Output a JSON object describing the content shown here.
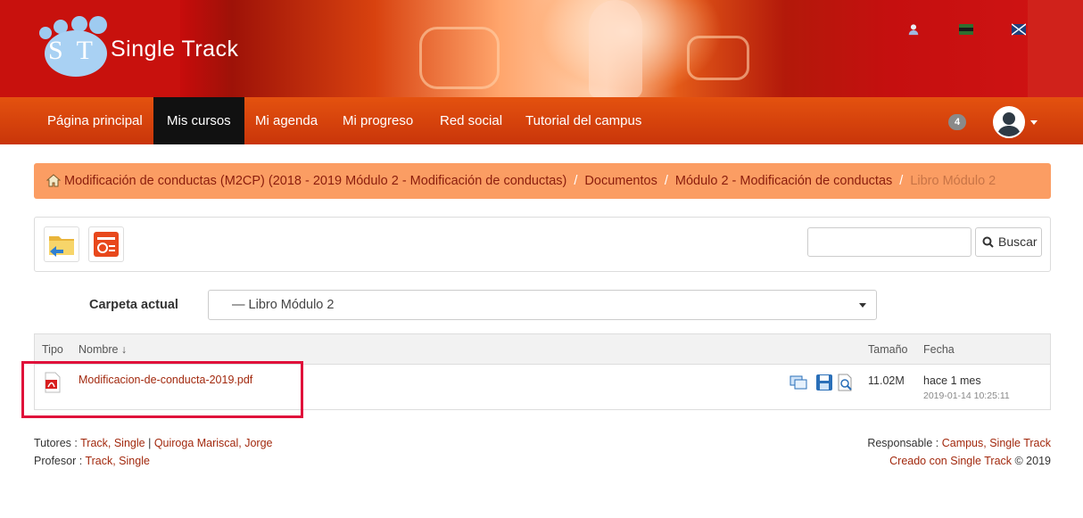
{
  "header": {
    "logo_letters": "S T",
    "brand": "Single Track",
    "icons": [
      "user-icon",
      "flag-es-icon",
      "flag-en-icon"
    ]
  },
  "nav": {
    "items": [
      {
        "label": "Página principal",
        "active": false
      },
      {
        "label": "Mis cursos",
        "active": true
      },
      {
        "label": "Mi agenda",
        "active": false
      },
      {
        "label": "Mi progreso",
        "active": false
      },
      {
        "label": "Red social",
        "active": false
      },
      {
        "label": "Tutorial del campus",
        "active": false
      }
    ],
    "notifications_count": "4"
  },
  "breadcrumb": {
    "items": [
      "Modificación de conductas (M2CP) (2018 - 2019 Módulo 2 - Modificación de conductas)",
      "Documentos",
      "Módulo 2 - Modificación de conductas"
    ],
    "current": "Libro Módulo 2",
    "separator": "/"
  },
  "toolbar": {
    "search_placeholder": "",
    "search_value": "",
    "search_button": "Buscar"
  },
  "folder": {
    "label": "Carpeta actual",
    "selected": "— Libro Módulo 2"
  },
  "table": {
    "headers": {
      "type": "Tipo",
      "name": "Nombre ↓",
      "size": "Tamaño",
      "date": "Fecha"
    },
    "rows": [
      {
        "icon": "pdf-icon",
        "name": "Modificacion-de-conducta-2019.pdf",
        "size": "11.02M",
        "date": "hace 1 mes",
        "timestamp": "2019-01-14 10:25:11"
      }
    ]
  },
  "footer": {
    "tutores_label": "Tutores :",
    "tutor_1": "Track, Single",
    "tutor_sep": "|",
    "tutor_2": "Quiroga Mariscal, Jorge",
    "profesor_label": "Profesor :",
    "profesor": "Track, Single",
    "responsable_label": "Responsable :",
    "responsable": "Campus, Single Track",
    "creado_prefix": "Creado con",
    "creado_link": "Single Track",
    "creado_suffix": "© 2019"
  },
  "colors": {
    "navbar": "#d8460d",
    "breadcrumb_bg": "#fb9d63",
    "link": "#a2290e",
    "highlight": "#e0103a"
  }
}
